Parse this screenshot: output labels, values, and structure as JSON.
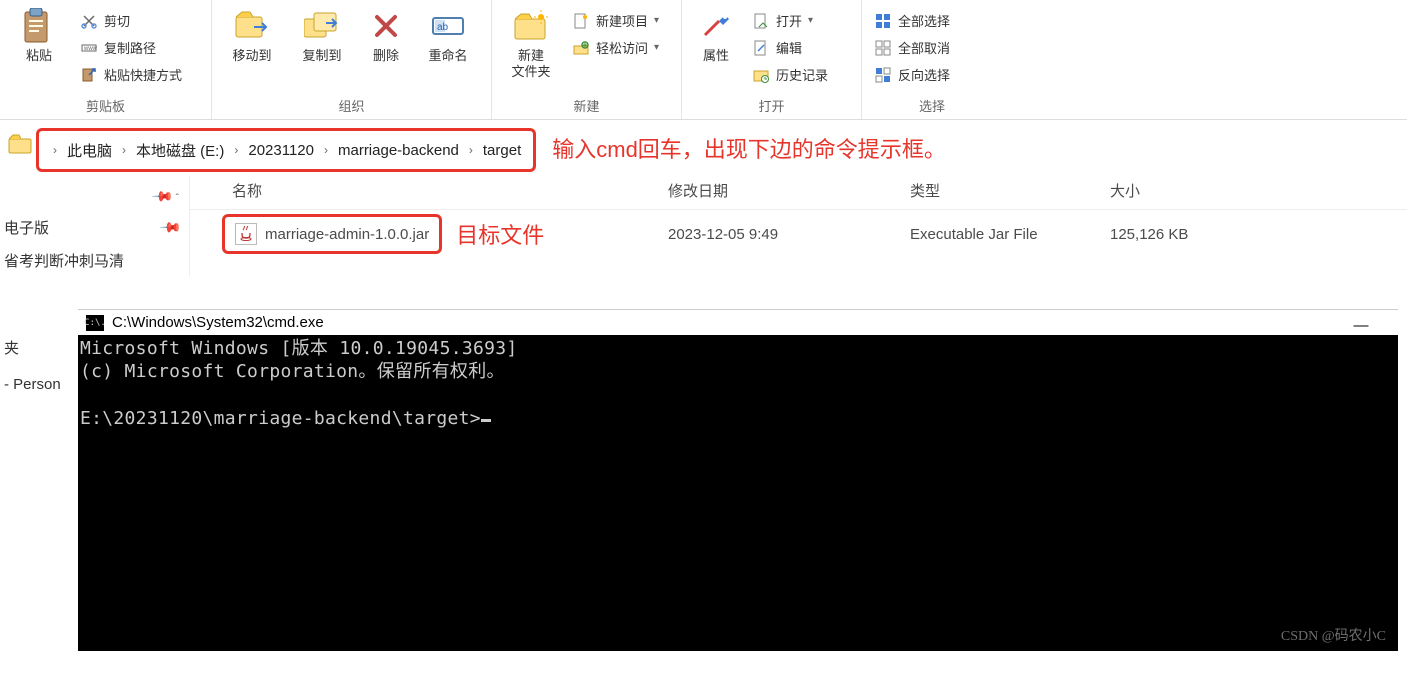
{
  "ribbon": {
    "clipboard": {
      "label": "剪贴板",
      "paste": "粘贴",
      "cut": "剪切",
      "copy_path": "复制路径",
      "paste_shortcut": "粘贴快捷方式"
    },
    "organize": {
      "label": "组织",
      "move_to": "移动到",
      "copy_to": "复制到",
      "delete": "删除",
      "rename": "重命名"
    },
    "new": {
      "label": "新建",
      "new_folder": "新建\n文件夹",
      "new_item": "新建项目",
      "easy_access": "轻松访问"
    },
    "open": {
      "label": "打开",
      "properties": "属性",
      "open": "打开",
      "edit": "编辑",
      "history": "历史记录"
    },
    "select": {
      "label": "选择",
      "select_all": "全部选择",
      "select_none": "全部取消",
      "invert": "反向选择"
    }
  },
  "breadcrumbs": [
    "此电脑",
    "本地磁盘 (E:)",
    "20231120",
    "marriage-backend",
    "target"
  ],
  "annotation_path": "输入cmd回车，出现下边的命令提示框。",
  "annotation_file": "目标文件",
  "left_nav": {
    "items": [
      "电子版",
      "省考判断冲刺马清"
    ],
    "footer_sep": "夹",
    "footer_personal": " - Person"
  },
  "columns": {
    "name": "名称",
    "date": "修改日期",
    "type": "类型",
    "size": "大小"
  },
  "file": {
    "name": "marriage-admin-1.0.0.jar",
    "date": "2023-12-05 9:49",
    "type": "Executable Jar File",
    "size": "125,126 KB"
  },
  "cmd": {
    "title_path": "C:\\Windows\\System32\\cmd.exe",
    "icon_text": "C:\\.",
    "line1": "Microsoft Windows [版本 10.0.19045.3693]",
    "line2": "(c) Microsoft Corporation。保留所有权利。",
    "prompt": "E:\\20231120\\marriage-backend\\target>",
    "minimize": "—"
  },
  "watermark": "CSDN @码农小C"
}
